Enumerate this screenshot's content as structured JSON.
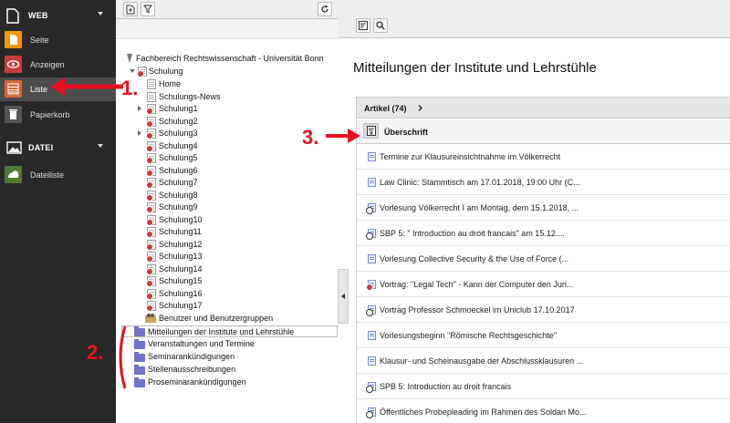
{
  "colors": {
    "accent_red": "#e8101e",
    "sidebar_bg": "#292929",
    "folder": "#6f73c9"
  },
  "module_menu": {
    "groups": [
      {
        "title": "WEB",
        "icon": "page-icon",
        "items": [
          {
            "label": "Seite",
            "icon": "page-module-icon",
            "color": "#f49700"
          },
          {
            "label": "Anzeigen",
            "icon": "eye-icon",
            "color": "#c83c3c"
          },
          {
            "label": "Liste",
            "icon": "list-icon",
            "color": "#d26a34",
            "active": true
          },
          {
            "label": "Papierkorb",
            "icon": "trash-icon",
            "color": "#555555"
          }
        ]
      },
      {
        "title": "DATEI",
        "icon": "image-icon",
        "items": [
          {
            "label": "Dateiliste",
            "icon": "file-list-icon",
            "color": "#4d7b30"
          }
        ]
      }
    ]
  },
  "page_tree": {
    "site_root": "Fachbereich Rechtswissenschaft - Universität Bonn",
    "nodes": [
      "Schulung",
      "Home",
      "Schulungs-News",
      "Schulung1",
      "Schulung2",
      "Schulung3",
      "Schulung4",
      "Schulung5",
      "Schulung6",
      "Schulung7",
      "Schulung8",
      "Schulung9",
      "Schulung10",
      "Schulung11",
      "Schulung12",
      "Schulung13",
      "Schulung14",
      "Schulung15",
      "Schulung16",
      "Schulung17",
      "Benutzer und Benutzergruppen"
    ],
    "folders": [
      "Mitteilungen der Institute und Lehrstühle",
      "Veranstaltungen und Termine",
      "Seminarankündigungen",
      "Stellenausschreibungen",
      "Proseminarankündigungen"
    ]
  },
  "content": {
    "page_title": "Mitteilungen der Institute und Lehrstühle",
    "table_title": "Artikel (74)",
    "column_header": "Überschrift",
    "rows": [
      {
        "text": "Termine zur Klausureinsichtnahme im Völkerrecht",
        "icon": "plain"
      },
      {
        "text": "Law Clinic: Stammtisch am 17.01.2018, 19:00 Uhr (C...",
        "icon": "plain"
      },
      {
        "text": "Vorlesung Völkerrecht I am Montag, dem 15.1.2018, ...",
        "icon": "clock"
      },
      {
        "text": "SBP 5: \" Introduction au droit francais\" am 15.12....",
        "icon": "clock"
      },
      {
        "text": "Vorlesung Collective Security & the Use of Force (...",
        "icon": "plain"
      },
      {
        "text": "Vortrag: \"Legal Tech\" - Kann der Computer den Juri...",
        "icon": "hidden"
      },
      {
        "text": "Vortrag Professor Schmoeckel im Uniclub 17.10.2017",
        "icon": "clock"
      },
      {
        "text": "Vorlesungsbeginn \"Römische Rechtsgeschichte\"",
        "icon": "plain"
      },
      {
        "text": "Klausur- und Scheinausgabe der Abschlussklausuren ...",
        "icon": "plain"
      },
      {
        "text": "SPB 5: Introduction au droit francais",
        "icon": "clock"
      },
      {
        "text": "Öffentliches Probepleading im Rahmen des Soldan Mo...",
        "icon": "clock"
      }
    ]
  },
  "annotations": {
    "step1": "1.",
    "step2": "2.",
    "step3": "3."
  }
}
